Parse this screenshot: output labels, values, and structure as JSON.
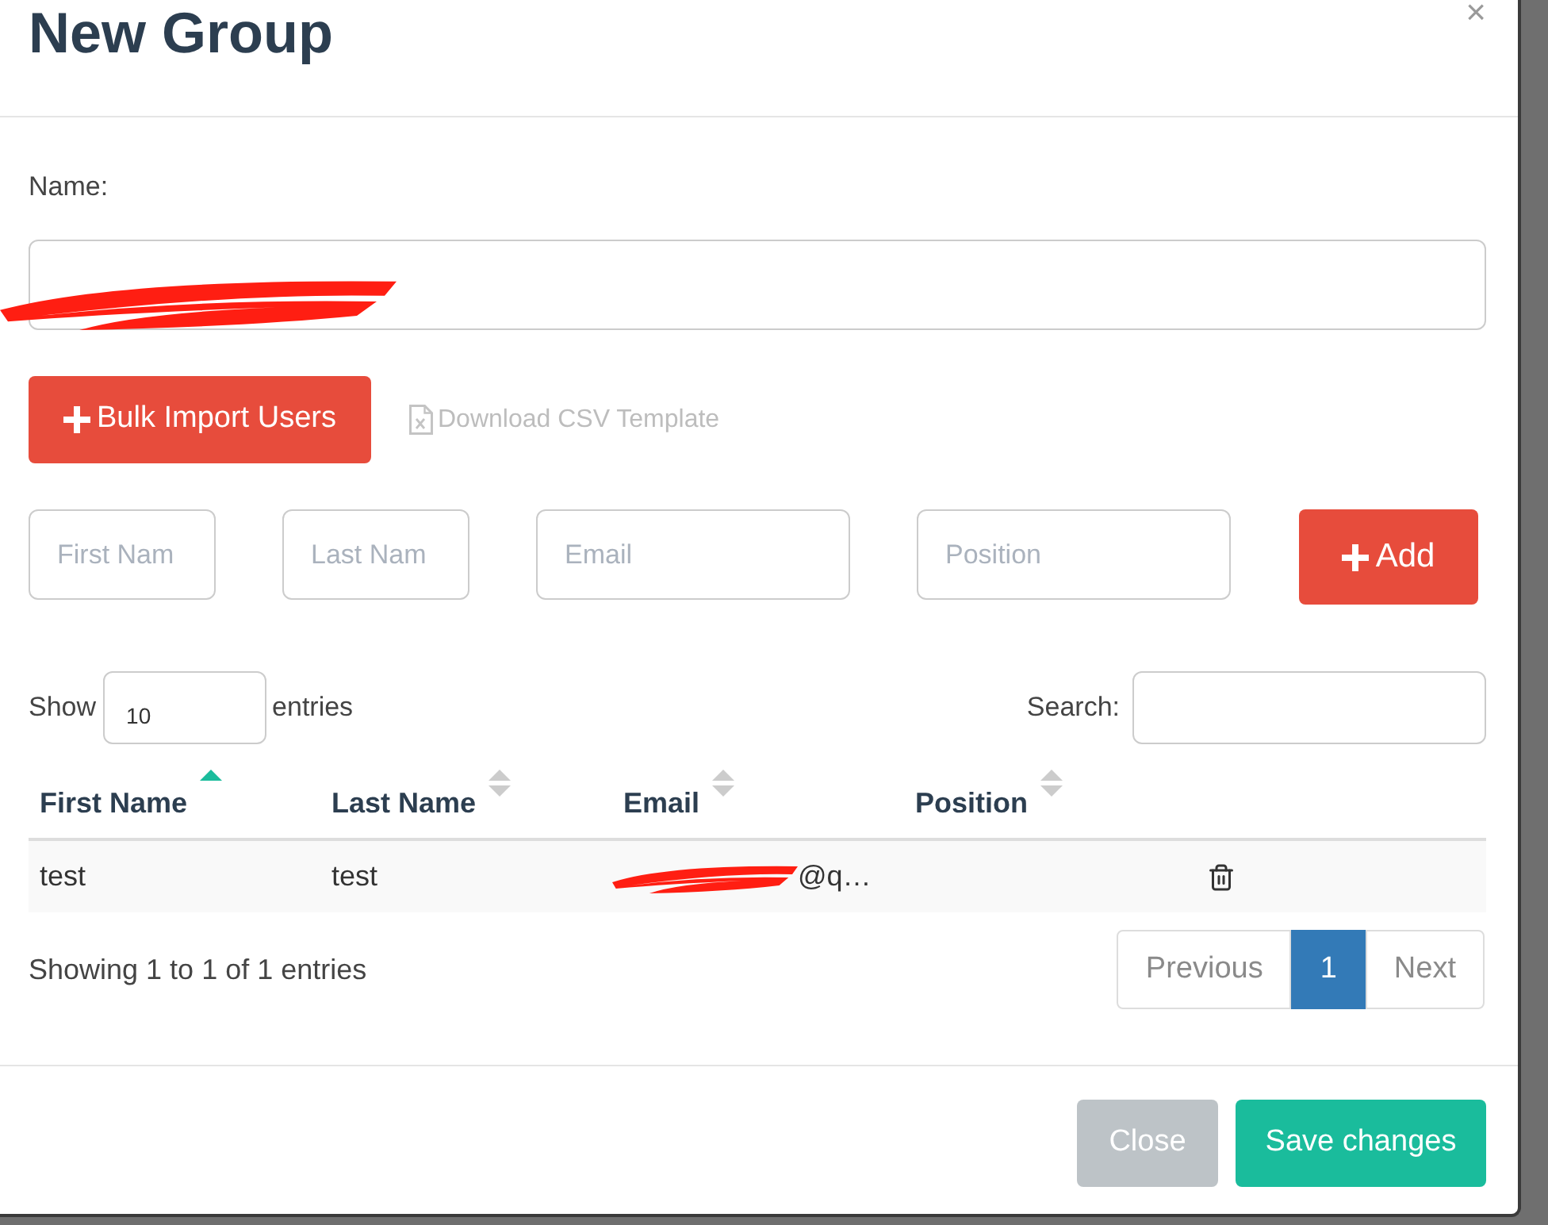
{
  "dialog": {
    "title": "New Group",
    "close_symbol": "×"
  },
  "name_field": {
    "label": "Name:",
    "redacted": true
  },
  "actions": {
    "bulk_import": "Bulk Import Users",
    "download_template": "Download CSV Template"
  },
  "new_user_fields": [
    {
      "placeholder": "First Nam"
    },
    {
      "placeholder": "Last Nam"
    },
    {
      "placeholder": "Email"
    },
    {
      "placeholder": "Position"
    }
  ],
  "add_button": "Add",
  "table_controls": {
    "show_label": "Show",
    "page_size": "10",
    "entries_label": "entries",
    "search_label": "Search:"
  },
  "table": {
    "columns": [
      {
        "label": "First Name",
        "sorted": true
      },
      {
        "label": "Last Name",
        "sorted": false
      },
      {
        "label": "Email",
        "sorted": false
      },
      {
        "label": "Position",
        "sorted": false
      }
    ],
    "rows": [
      {
        "first_name": "test",
        "last_name": "test",
        "email": "@q…",
        "email_redacted": true
      }
    ]
  },
  "pagination": {
    "info": "Showing 1 to 1 of 1 entries",
    "pages": [
      {
        "label": "Previous",
        "selected": false,
        "disabled": true
      },
      {
        "label": "1",
        "selected": true,
        "disabled": false
      },
      {
        "label": "Next",
        "selected": false,
        "disabled": true
      }
    ]
  },
  "footer": {
    "buttons": [
      {
        "label": "Close",
        "kind": "secondary"
      },
      {
        "label": "Save changes",
        "kind": "primary"
      }
    ]
  }
}
